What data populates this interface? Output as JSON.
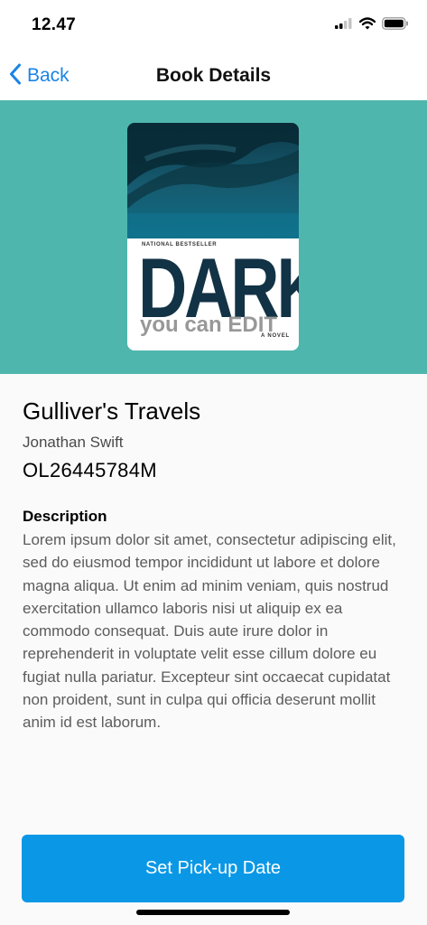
{
  "status_bar": {
    "time": "12.47",
    "icons": [
      "signal-icon",
      "wifi-icon",
      "battery-icon"
    ]
  },
  "nav": {
    "back_label": "Back",
    "title": "Book Details",
    "accent_color": "#1a84e6"
  },
  "hero": {
    "background_color": "#4fb6ad",
    "cover": {
      "tagline": "NATIONAL BESTSELLER",
      "title": "DARK",
      "subtitle": "you can EDIT",
      "novel_label": "A NOVEL"
    }
  },
  "book": {
    "title": "Gulliver's Travels",
    "author": "Jonathan Swift",
    "id": "OL26445784M"
  },
  "description": {
    "heading": "Description",
    "body": "Lorem ipsum dolor sit amet, consectetur adipiscing elit, sed do eiusmod tempor incididunt ut labore et dolore magna aliqua. Ut enim ad minim veniam, quis nostrud exercitation ullamco laboris nisi ut aliquip ex ea commodo consequat. Duis aute irure dolor in reprehenderit in voluptate velit esse cillum dolore eu fugiat nulla pariatur. Excepteur sint occaecat cupidatat non proident, sunt in culpa qui officia deserunt mollit anim id est laborum."
  },
  "cta": {
    "label": "Set Pick-up Date",
    "color": "#0a98e6"
  }
}
